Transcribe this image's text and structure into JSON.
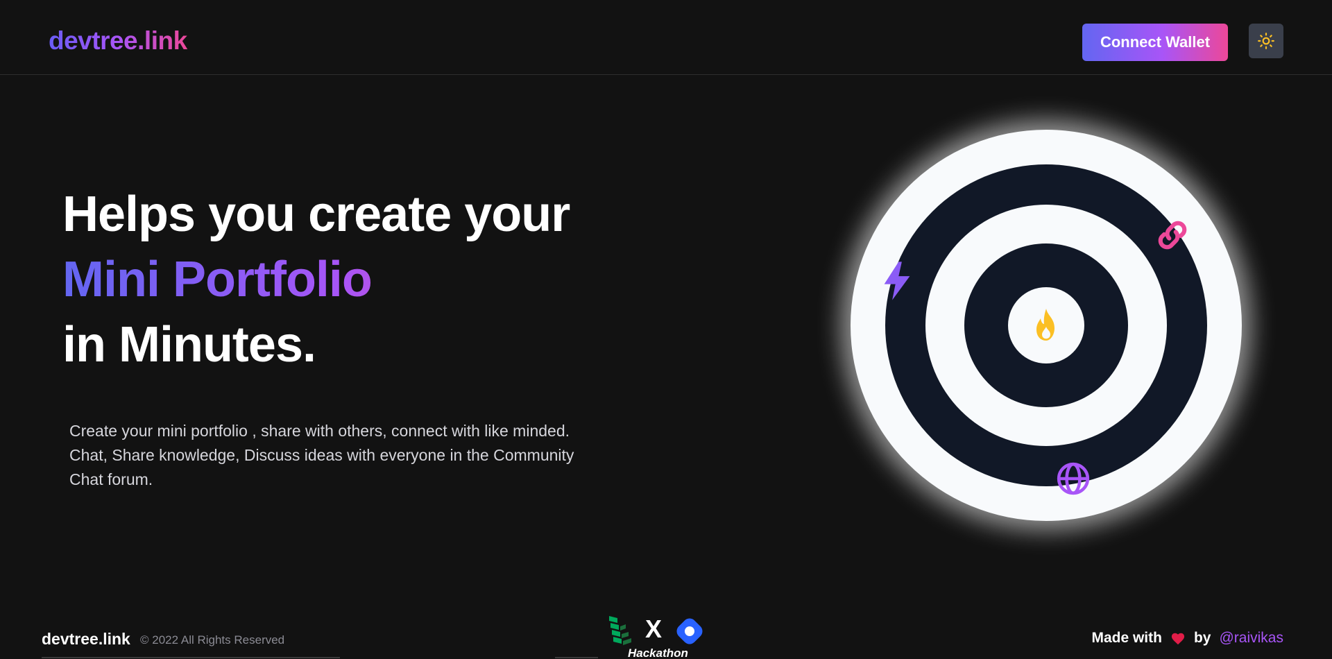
{
  "header": {
    "brand": "devtree.link",
    "connect_label": "Connect Wallet",
    "theme_icon": "sun-icon"
  },
  "hero": {
    "title_line_1": "Helps you create your",
    "title_highlight": "Mini Portfolio",
    "title_line_3": "in Minutes.",
    "description_lines": [
      "Create your mini portfolio , share with others, connect with like minded.",
      "Chat, Share knowledge, Discuss ideas with everyone in the Community",
      "Chat forum."
    ]
  },
  "illustration": {
    "icons": [
      "fire-icon",
      "link-icon",
      "bolt-icon",
      "globe-icon"
    ]
  },
  "footer": {
    "brand": "devtree.link",
    "copyright": "© 2022 All Rights Reserved",
    "hackathon_label": "Hackathon",
    "hackathon_x": "X",
    "made_with": "Made with",
    "by": "by",
    "author": "@raivikas"
  },
  "colors": {
    "background": "#121212",
    "gradient_start": "#6366f1",
    "gradient_mid": "#a855f7",
    "gradient_end": "#ec4899",
    "ring_dark": "#111827",
    "ring_light": "#f8fafc",
    "fire": "#fbbf24",
    "heart": "#e11d48"
  }
}
